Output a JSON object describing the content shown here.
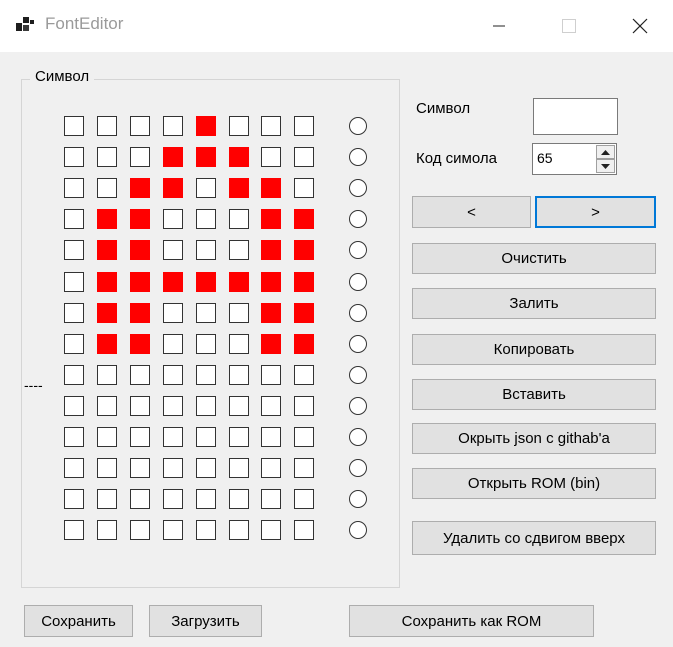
{
  "window": {
    "title": "FontEditor"
  },
  "group": {
    "label": "Символ"
  },
  "grid": {
    "rows": [
      [
        0,
        0,
        0,
        0,
        1,
        0,
        0,
        0
      ],
      [
        0,
        0,
        0,
        1,
        1,
        1,
        0,
        0
      ],
      [
        0,
        0,
        1,
        1,
        0,
        1,
        1,
        0
      ],
      [
        0,
        1,
        1,
        0,
        0,
        0,
        1,
        1
      ],
      [
        0,
        1,
        1,
        0,
        0,
        0,
        1,
        1
      ],
      [
        0,
        1,
        1,
        1,
        1,
        1,
        1,
        1
      ],
      [
        0,
        1,
        1,
        0,
        0,
        0,
        1,
        1
      ],
      [
        0,
        1,
        1,
        0,
        0,
        0,
        1,
        1
      ],
      [
        0,
        0,
        0,
        0,
        0,
        0,
        0,
        0
      ],
      [
        0,
        0,
        0,
        0,
        0,
        0,
        0,
        0
      ],
      [
        0,
        0,
        0,
        0,
        0,
        0,
        0,
        0
      ],
      [
        0,
        0,
        0,
        0,
        0,
        0,
        0,
        0
      ],
      [
        0,
        0,
        0,
        0,
        0,
        0,
        0,
        0
      ],
      [
        0,
        0,
        0,
        0,
        0,
        0,
        0,
        0
      ]
    ],
    "on_color": "#ff0000",
    "row_marker": "----"
  },
  "symbol": {
    "label": "Символ",
    "value": ""
  },
  "code": {
    "label": "Код симола",
    "value": "65"
  },
  "nav": {
    "prev": "<",
    "next": ">"
  },
  "buttons": {
    "clear": "Очистить",
    "fill": "Залить",
    "copy": "Копировать",
    "paste": "Вставить",
    "open_json": "Окрыть json с githab'a",
    "open_rom": "Открыть ROM (bin)",
    "delete_shift_up": "Удалить со сдвигом вверх",
    "save": "Сохранить",
    "load": "Загрузить",
    "save_rom": "Сохранить как ROM"
  },
  "icons": {
    "app": "app-icon",
    "minimize": "minimize-icon",
    "maximize": "maximize-icon",
    "close": "close-icon"
  }
}
